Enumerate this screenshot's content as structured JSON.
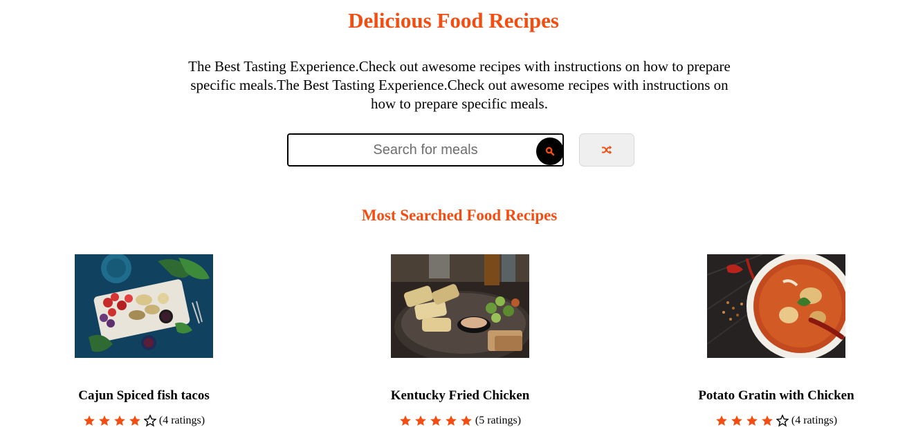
{
  "header": {
    "title": "Delicious Food Recipes",
    "intro": "The Best Tasting Experience.Check out awesome recipes with instructions on how to prepare specific meals.The Best Tasting Experience.Check out awesome recipes with instructions on how to prepare specific meals."
  },
  "search": {
    "placeholder": "Search for meals",
    "value": "",
    "search_icon": "search-icon",
    "random_icon": "shuffle-icon"
  },
  "section": {
    "title": "Most Searched Food Recipes"
  },
  "recipes": [
    {
      "name": "Cajun Spiced fish tacos",
      "rating": 4,
      "max_rating": 5,
      "ratings_label": "(4 ratings)"
    },
    {
      "name": "Kentucky Fried Chicken",
      "rating": 5,
      "max_rating": 5,
      "ratings_label": "(5 ratings)"
    },
    {
      "name": "Potato Gratin with Chicken",
      "rating": 4,
      "max_rating": 5,
      "ratings_label": "(4 ratings)"
    }
  ],
  "colors": {
    "accent": "#f44d12",
    "text": "#000000",
    "button_bg": "#efefef"
  }
}
